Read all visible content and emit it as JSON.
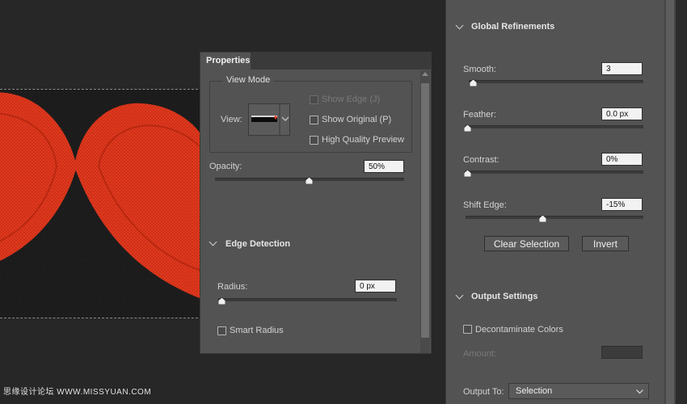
{
  "canvas": {
    "background_color": "#1b1b1b",
    "heart_color": "#e8361e"
  },
  "properties_panel": {
    "tab_label": "Properties",
    "view_mode": {
      "legend": "View Mode",
      "view_label": "View:",
      "show_edge": "Show Edge (J)",
      "show_original": "Show Original (P)",
      "high_quality_preview": "High Quality Preview"
    },
    "opacity": {
      "label": "Opacity:",
      "value": "50%",
      "level": 0.5
    },
    "edge_detection": {
      "title": "Edge Detection",
      "radius_label": "Radius:",
      "radius_value": "0 px",
      "radius_level": 0,
      "smart_radius": "Smart Radius"
    }
  },
  "global_refinements": {
    "title": "Global Refinements",
    "smooth": {
      "label": "Smooth:",
      "value": "3",
      "level": 0.03
    },
    "feather": {
      "label": "Feather:",
      "value": "0.0 px",
      "level": 0
    },
    "contrast": {
      "label": "Contrast:",
      "value": "0%",
      "level": 0
    },
    "shift_edge": {
      "label": "Shift Edge:",
      "value": "-15%",
      "level": 0.425
    },
    "clear_selection": "Clear Selection",
    "invert": "Invert"
  },
  "output_settings": {
    "title": "Output Settings",
    "decontaminate": "Decontaminate Colors",
    "amount_label": "Amount:",
    "output_to_label": "Output To:",
    "output_to_value": "Selection"
  },
  "watermark": "思缘设计论坛 WWW.MISSYUAN.COM"
}
